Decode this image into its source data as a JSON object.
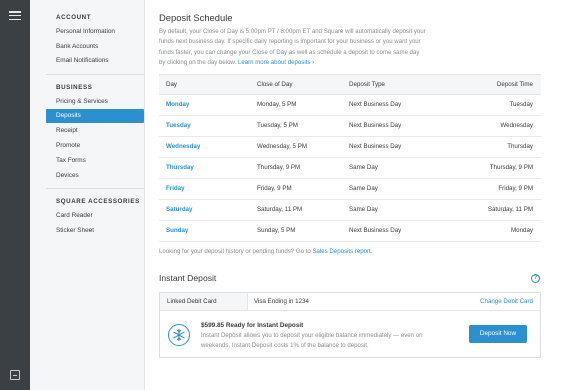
{
  "sidebar": {
    "account_heading": "ACCOUNT",
    "account_items": [
      {
        "label": "Personal Information"
      },
      {
        "label": "Bank Accounts"
      },
      {
        "label": "Email Notifications"
      }
    ],
    "business_heading": "BUSINESS",
    "business_items": [
      {
        "label": "Pricing & Services"
      },
      {
        "label": "Deposits",
        "active": true
      },
      {
        "label": "Receipt"
      },
      {
        "label": "Promote"
      },
      {
        "label": "Tax Forms"
      },
      {
        "label": "Devices"
      }
    ],
    "accessories_heading": "SQUARE ACCESSORIES",
    "accessories_items": [
      {
        "label": "Card Reader"
      },
      {
        "label": "Sticker Sheet"
      }
    ]
  },
  "main": {
    "title": "Deposit Schedule",
    "intro": "By default, your Close of Day is 5:00pm PT / 8:00pm ET and Square will automatically deposit your funds next business day. If specific daily reporting is important for your business or you want your funds faster, you can change your Close of Day as well as schedule a deposit to come same day by clicking on the day below.",
    "intro_link": "Learn more about deposits ›",
    "table": {
      "headers": [
        "Day",
        "Close of Day",
        "Deposit Type",
        "Deposit Time"
      ],
      "rows": [
        {
          "day": "Monday",
          "close": "Monday, 5 PM",
          "type": "Next Business Day",
          "time": "Tuesday"
        },
        {
          "day": "Tuesday",
          "close": "Tuesday, 5 PM",
          "type": "Next Business Day",
          "time": "Wednesday"
        },
        {
          "day": "Wednesday",
          "close": "Wednesday, 5 PM",
          "type": "Next Business Day",
          "time": "Thursday"
        },
        {
          "day": "Thursday",
          "close": "Thursday, 9 PM",
          "type": "Same Day",
          "time": "Thursday, 9 PM"
        },
        {
          "day": "Friday",
          "close": "Friday, 9 PM",
          "type": "Same Day",
          "time": "Friday, 9 PM"
        },
        {
          "day": "Saturday",
          "close": "Saturday, 11 PM",
          "type": "Same Day",
          "time": "Saturday, 11 PM"
        },
        {
          "day": "Sunday",
          "close": "Sunday, 5 PM",
          "type": "Next Business Day",
          "time": "Monday"
        }
      ]
    },
    "history_note": "Looking for your deposit history or pending funds? Go to",
    "history_link": "Sales Deposits report.",
    "instant": {
      "title": "Instant Deposit",
      "help_glyph": "?",
      "card_label": "Linked Debit Card",
      "card_value": "Visa Ending in 1234",
      "change_link": "Change Debit Card",
      "ready": "$599.85 Ready for Instant Deposit",
      "description": "Instant Deposit allows you to deposit your eligible balance immediately — even on weekends. Instant Deposit costs 1% of the balance to deposit.",
      "button": "Deposit Now"
    }
  },
  "icons": {
    "menu": "hamburger-icon",
    "bottom": "sign-out-icon",
    "help": "help-icon",
    "instant": "lightning-icon"
  },
  "colors": {
    "accent": "#2b8fd0",
    "rail": "#3b4045",
    "sidebar": "#f5f6f7"
  }
}
